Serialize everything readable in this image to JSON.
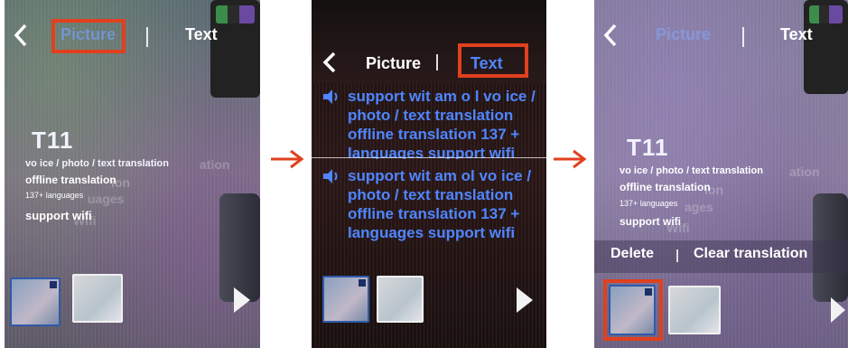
{
  "panels": [
    {
      "tabs": {
        "picture_label": "Picture",
        "text_label": "Text"
      },
      "ocr": {
        "title": "T11",
        "lines": [
          "vo ice / photo / text translation",
          "offline translation",
          "137+ languages",
          "support wifi"
        ],
        "ghost_lines": [
          "ation",
          "ion",
          "uages",
          "Wifi"
        ]
      }
    },
    {
      "tabs": {
        "picture_label": "Picture",
        "text_label": "Text"
      },
      "translations": [
        {
          "text": "support wit am o l vo ice / photo / text translation offline translation 137 + languages support wifi"
        },
        {
          "text": "support wit am ol vo ice / photo / text translation offline translation 137 + languages support wifi"
        }
      ]
    },
    {
      "tabs": {
        "picture_label": "Picture",
        "text_label": "Text"
      },
      "ocr": {
        "title": "T11",
        "lines": [
          "vo ice / photo / text translation",
          "offline translation",
          "137+ languages",
          "support wifi"
        ],
        "ghost_lines": [
          "ation",
          "ion",
          "ages",
          "Wifi"
        ]
      },
      "actions": {
        "delete_label": "Delete",
        "clear_label": "Clear translation"
      }
    }
  ],
  "icons": {
    "back": "chevron-left-icon",
    "next": "play-triangle-icon",
    "speaker": "speaker-icon",
    "arrow": "right-arrow-icon"
  },
  "colors": {
    "highlight": "#e0401f",
    "accent_text": "#4f86ff",
    "arrow": "#e0401f"
  }
}
